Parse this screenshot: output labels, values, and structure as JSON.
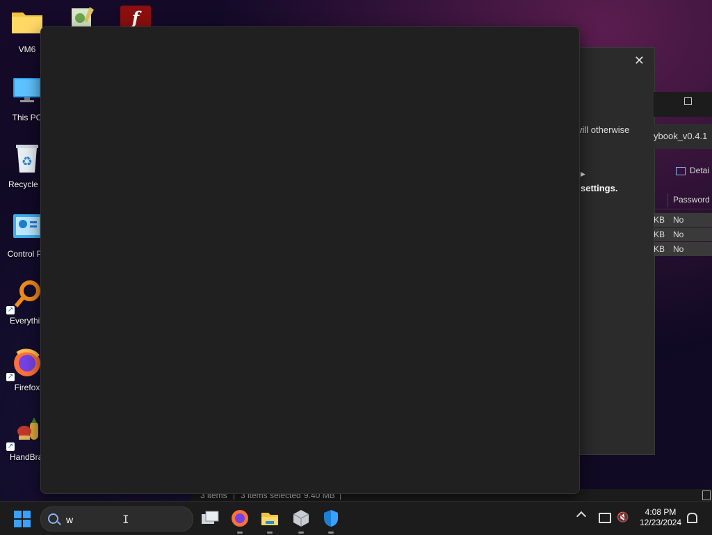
{
  "desktop": {
    "icons": [
      {
        "label": "VM6"
      },
      {
        "label": "This PC"
      },
      {
        "label": "Recycle B"
      },
      {
        "label": "Control Pa"
      },
      {
        "label": "Everythin"
      },
      {
        "label": "Firefox"
      },
      {
        "label": "HandBral"
      }
    ]
  },
  "dialog": {
    "text_fragment": "vill otherwise",
    "bold_fragment": "settings."
  },
  "explorer": {
    "path_fragment": "ybook_v0.4.1",
    "details_label": "Detai",
    "column_password": "Password .",
    "rows": [
      {
        "size_unit": "KB",
        "password": "No"
      },
      {
        "size_unit": "KB",
        "password": "No"
      },
      {
        "size_unit": "KB",
        "password": "No"
      }
    ],
    "status": {
      "items": "3 items",
      "selected": "3 items selected",
      "size": "9.40 MB"
    }
  },
  "taskbar": {
    "search_value": "w",
    "apps": [
      "task-view",
      "firefox",
      "file-explorer",
      "virtualbox",
      "defender"
    ],
    "clock": {
      "time": "4:08 PM",
      "date": "12/23/2024"
    }
  },
  "colors": {
    "accent": "#3aa0ff",
    "flyout_bg": "#202020",
    "taskbar_bg": "#1c1c1c"
  }
}
